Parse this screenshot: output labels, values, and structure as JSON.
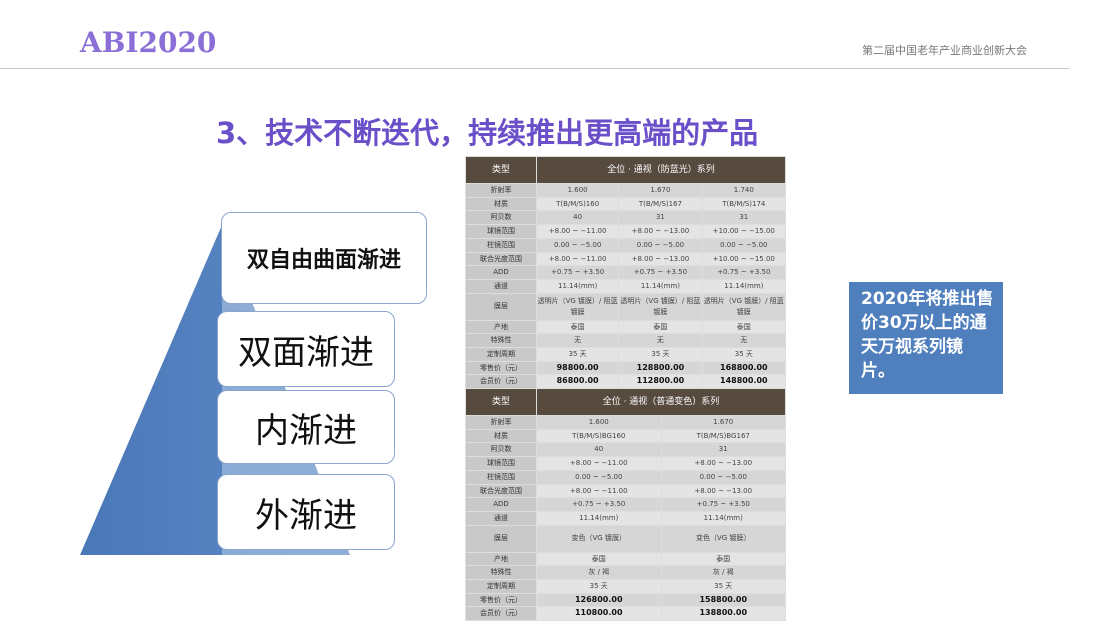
{
  "header": {
    "logo": "ABI2020",
    "conference": "第二届中国老年产业商业创新大会"
  },
  "title": "3、技术不断迭代，持续推出更高端的产品",
  "pyramid": {
    "levels": [
      "双自由曲面渐进",
      "双面渐进",
      "内渐进",
      "外渐进"
    ]
  },
  "table1": {
    "header": [
      "类型",
      "全位 · 通视（防蓝光）系列"
    ],
    "rows": [
      {
        "label": "折射率",
        "values": [
          "1.600",
          "1.670",
          "1.740"
        ]
      },
      {
        "label": "材质",
        "values": [
          "T(B/M/S)160",
          "T(B/M/S)167",
          "T(B/M/S)174"
        ]
      },
      {
        "label": "阿贝数",
        "values": [
          "40",
          "31",
          "31"
        ]
      },
      {
        "label": "球镜范围",
        "values": [
          "+8.00 ~ −11.00",
          "+8.00 ~ −13.00",
          "+10.00 ~ −15.00"
        ]
      },
      {
        "label": "柱镜范围",
        "values": [
          "0.00 ~ −5.00",
          "0.00 ~ −5.00",
          "0.00 ~ −5.00"
        ]
      },
      {
        "label": "联合光度范围",
        "values": [
          "+8.00 ~ −11.00",
          "+8.00 ~ −13.00",
          "+10.00 ~ −15.00"
        ]
      },
      {
        "label": "ADD",
        "values": [
          "+0.75 ~ +3.50",
          "+0.75 ~ +3.50",
          "+0.75 ~ +3.50"
        ]
      },
      {
        "label": "通道",
        "values": [
          "11.14(mm)",
          "11.14(mm)",
          "11.14(mm)"
        ]
      },
      {
        "label": "膜层",
        "values": [
          "透明片（VG 镀膜）/ 阻蓝镀膜",
          "透明片（VG 镀膜）/ 阻蓝镀膜",
          "透明片（VG 镀膜）/ 阻蓝镀膜"
        ]
      },
      {
        "label": "产地",
        "values": [
          "泰国",
          "泰国",
          "泰国"
        ]
      },
      {
        "label": "特殊性",
        "values": [
          "无",
          "无",
          "无"
        ]
      },
      {
        "label": "定制周期",
        "values": [
          "35 天",
          "35 天",
          "35 天"
        ]
      },
      {
        "label": "零售价（元）",
        "values": [
          "98800.00",
          "128800.00",
          "168800.00"
        ]
      },
      {
        "label": "会员价（元）",
        "values": [
          "86800.00",
          "112800.00",
          "148800.00"
        ]
      }
    ]
  },
  "table2": {
    "header": [
      "类型",
      "全位 · 通视（普通变色）系列"
    ],
    "rows": [
      {
        "label": "折射率",
        "values": [
          "1.600",
          "1.670"
        ]
      },
      {
        "label": "材质",
        "values": [
          "T(B/M/S)BG160",
          "T(B/M/S)BG167"
        ]
      },
      {
        "label": "阿贝数",
        "values": [
          "40",
          "31"
        ]
      },
      {
        "label": "球镜范围",
        "values": [
          "+8.00 ~ −11.00",
          "+8.00 ~ −13.00"
        ]
      },
      {
        "label": "柱镜范围",
        "values": [
          "0.00 ~ −5.00",
          "0.00 ~ −5.00"
        ]
      },
      {
        "label": "联合光度范围",
        "values": [
          "+8.00 ~ −11.00",
          "+8.00 ~ −13.00"
        ]
      },
      {
        "label": "ADD",
        "values": [
          "+0.75 ~ +3.50",
          "+0.75 ~ +3.50"
        ]
      },
      {
        "label": "通道",
        "values": [
          "11.14(mm)",
          "11.14(mm)"
        ]
      },
      {
        "label": "膜层",
        "values": [
          "变色（VG 镀膜）",
          "变色（VG 镀膜）"
        ]
      },
      {
        "label": "产地",
        "values": [
          "泰国",
          "泰国"
        ]
      },
      {
        "label": "特殊性",
        "values": [
          "灰 / 褐",
          "灰 / 褐"
        ]
      },
      {
        "label": "定制周期",
        "values": [
          "35 天",
          "35 天"
        ]
      },
      {
        "label": "零售价（元）",
        "values": [
          "126800.00",
          "158800.00"
        ]
      },
      {
        "label": "会员价（元）",
        "values": [
          "110800.00",
          "138800.00"
        ]
      }
    ]
  },
  "callout": "2020年将推出售价30万以上的通天万视系列镜片。",
  "colors": {
    "logo": "#8a6fd6",
    "title": "#6a4fc9",
    "pyramid": "#4f7fbd",
    "table_header": "#574a3e",
    "callout": "#4f7fbd"
  }
}
